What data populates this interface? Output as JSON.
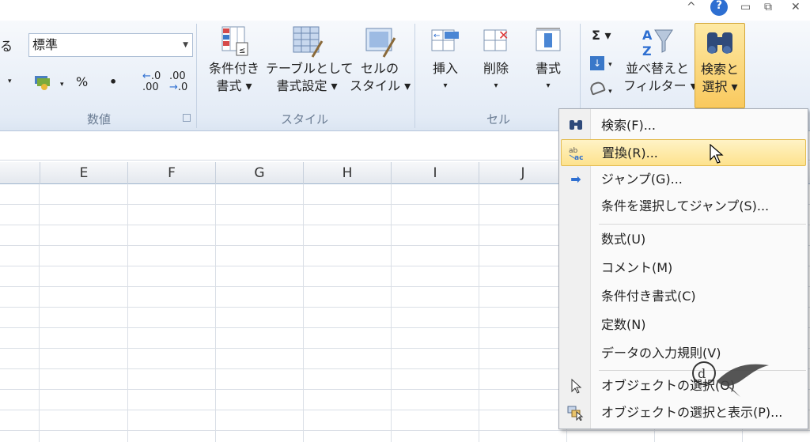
{
  "title_bar": {
    "controls": [
      "^",
      "?",
      "▭",
      "⧉",
      "✕"
    ]
  },
  "ribbon": {
    "left_cut_text": "る",
    "number_format": {
      "value": "標準"
    },
    "number_buttons": {
      "accounting": "▾",
      "percent": "%",
      "comma": "•",
      "inc_decimal": ".00",
      "dec_decimal": ".00"
    },
    "groups": {
      "number": "数値",
      "style": "スタイル",
      "cells": "セル"
    },
    "style_buttons": [
      {
        "line1": "条件付き",
        "line2": "書式 ▾"
      },
      {
        "line1": "テーブルとして",
        "line2": "書式設定 ▾"
      },
      {
        "line1": "セルの",
        "line2": "スタイル ▾"
      }
    ],
    "cells_buttons": [
      {
        "line1": "挿入",
        "line2": "▾"
      },
      {
        "line1": "削除",
        "line2": "▾"
      },
      {
        "line1": "書式",
        "line2": "▾"
      }
    ],
    "edit_small": {
      "sum": "Σ ▾",
      "fill": "▾",
      "clear": "▾"
    },
    "edit_buttons": [
      {
        "line1": "並べ替えと",
        "line2": "フィルター ▾"
      },
      {
        "line1": "検索と",
        "line2": "選択 ▾"
      }
    ]
  },
  "columns": [
    "E",
    "F",
    "G",
    "H",
    "I",
    "J"
  ],
  "menu": {
    "items": [
      {
        "icon": "binoculars-icon",
        "label": "検索(F)..."
      },
      {
        "icon": "replace-icon",
        "label": "置換(R)..."
      },
      {
        "icon": "arrow-right-icon",
        "label": "ジャンプ(G)..."
      },
      {
        "icon": "",
        "label": "条件を選択してジャンプ(S)..."
      },
      {
        "icon": "",
        "label": "数式(U)"
      },
      {
        "icon": "",
        "label": "コメント(M)"
      },
      {
        "icon": "",
        "label": "条件付き書式(C)"
      },
      {
        "icon": "",
        "label": "定数(N)"
      },
      {
        "icon": "",
        "label": "データの入力規則(V)"
      },
      {
        "icon": "select-objects-icon",
        "label": "オブジェクトの選択(O)"
      },
      {
        "icon": "selection-pane-icon",
        "label": "オブジェクトの選択と表示(P)..."
      }
    ],
    "highlighted_index": 1
  },
  "colors": {
    "ribbon_bg": "#e3ebf6",
    "highlight": "#fde28d",
    "arrow_blue": "#2e6fd1"
  }
}
